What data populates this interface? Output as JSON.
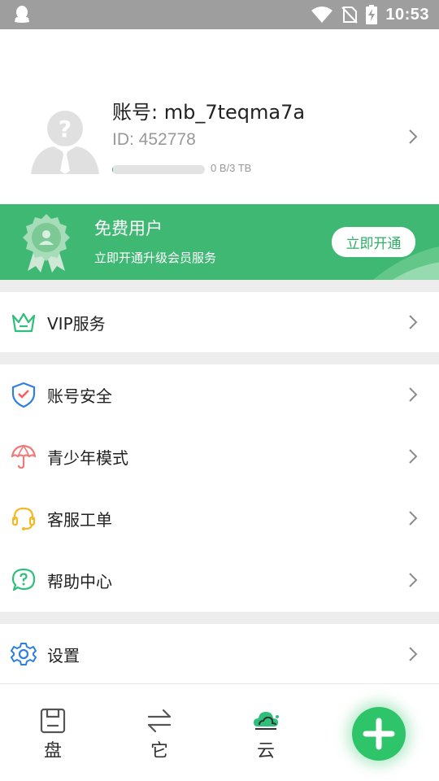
{
  "status_bar": {
    "time": "10:53"
  },
  "profile": {
    "account": "账号: mb_7teqma7a",
    "id": "ID: 452778",
    "storage": {
      "text": "0 B/3 TB",
      "used_fraction": 0.01
    }
  },
  "banner": {
    "title": "免费用户",
    "subtitle": "立即开通升级会员服务",
    "button": "立即开通"
  },
  "menu": {
    "vip": "VIP服务",
    "security": "账号安全",
    "youth": "青少年模式",
    "support": "客服工单",
    "help": "帮助中心",
    "settings": "设置"
  },
  "bottom_nav": {
    "tabs": [
      {
        "label": "盘",
        "icon": "save-icon"
      },
      {
        "label": "它",
        "icon": "transfer-icon"
      },
      {
        "label": "云",
        "icon": "cloud-icon"
      }
    ],
    "fab_icon": "plus-icon"
  },
  "colors": {
    "accent": "#3fb874",
    "status_bar": "#9e9e9e",
    "separator": "#ededed"
  }
}
